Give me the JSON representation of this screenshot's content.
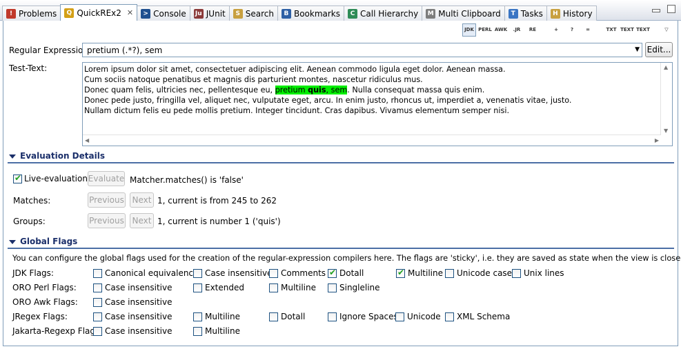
{
  "tabs": [
    {
      "label": "Problems",
      "icon": "problems-icon",
      "color": "#c0392b",
      "glyph": "!"
    },
    {
      "label": "QuickREx2",
      "icon": "quickrex-icon",
      "color": "#d4a017",
      "glyph": "Q",
      "active": true,
      "closable": true
    },
    {
      "label": "Console",
      "icon": "console-icon",
      "color": "#1f4f8f",
      "glyph": ">"
    },
    {
      "label": "JUnit",
      "icon": "junit-icon",
      "color": "#8b3a3a",
      "glyph": "Ju"
    },
    {
      "label": "Search",
      "icon": "search-icon",
      "color": "#c8a040",
      "glyph": "S"
    },
    {
      "label": "Bookmarks",
      "icon": "bookmarks-icon",
      "color": "#2d5fa5",
      "glyph": "B"
    },
    {
      "label": "Call Hierarchy",
      "icon": "call-hierarchy-icon",
      "color": "#2e8b57",
      "glyph": "C"
    },
    {
      "label": "Multi Clipboard",
      "icon": "multi-clipboard-icon",
      "color": "#7d7d7d",
      "glyph": "M"
    },
    {
      "label": "Tasks",
      "icon": "tasks-icon",
      "color": "#3a75c4",
      "glyph": "T"
    },
    {
      "label": "History",
      "icon": "history-icon",
      "color": "#c8a040",
      "glyph": "H"
    }
  ],
  "toolbar": [
    {
      "name": "jdk-regex-toggle",
      "glyph": "JDK"
    },
    {
      "name": "perl-regex-button",
      "glyph": "PERL"
    },
    {
      "name": "awk-regex-button",
      "glyph": "AWK"
    },
    {
      "name": "jregex-button",
      "glyph": ".JR"
    },
    {
      "name": "jakarta-regex-button",
      "glyph": "RE"
    },
    {
      "name": "add-to-library-button",
      "glyph": "+"
    },
    {
      "name": "organize-button",
      "glyph": "?"
    },
    {
      "name": "copy-to-clipboard-button",
      "glyph": "="
    },
    {
      "name": "text-button-1",
      "glyph": "TXT"
    },
    {
      "name": "text-button-2",
      "glyph": "TEXT"
    },
    {
      "name": "text-button-3",
      "glyph": "TEXT"
    },
    {
      "name": "view-menu-button",
      "glyph": "▽"
    }
  ],
  "regex": {
    "label": "Regular Expression:",
    "value": "pretium (.*?), sem",
    "edit_button": "Edit..."
  },
  "test_text": {
    "label": "Test-Text:",
    "line1": "Lorem ipsum dolor sit amet, consectetuer adipiscing elit. Aenean commodo ligula eget dolor. Aenean massa.",
    "line2": "Cum sociis natoque penatibus et magnis dis parturient montes, nascetur ridiculus mus.",
    "line3_pre": "Donec quam felis, ultricies nec, pellentesque eu, ",
    "line3_match_a": "pretium ",
    "line3_match_b": "quis",
    "line3_match_c": ", sem",
    "line3_post": ". Nulla consequat massa quis enim.",
    "line4": "Donec pede justo, fringilla vel, aliquet nec, vulputate eget, arcu. In enim justo, rhoncus ut, imperdiet a, venenatis vitae, justo.",
    "line5": "Nullam dictum felis eu pede mollis pretium. Integer tincidunt. Cras dapibus. Vivamus elementum semper nisi.",
    "highlight_color": "#00ee00"
  },
  "evaluation": {
    "title": "Evaluation Details",
    "live_label": "Live-evaluation",
    "live_checked": true,
    "evaluate_button": "Evaluate",
    "matcher_text": "Matcher.matches() is 'false'",
    "matches_label": "Matches:",
    "previous_button": "Previous",
    "next_button": "Next",
    "matches_text": "1, current is from 245 to 262",
    "groups_label": "Groups:",
    "groups_text": "1, current is number 1 ('quis')"
  },
  "flags": {
    "title": "Global Flags",
    "description": "You can configure the global flags used for the creation of the regular-expression compilers here. The flags are 'sticky', i.e. they are saved as state when the view is closed.",
    "jdk": {
      "label": "JDK Flags:",
      "items": [
        {
          "text": "Canonical equivalence",
          "checked": false
        },
        {
          "text": "Case insensitive",
          "checked": false
        },
        {
          "text": "Comments",
          "checked": false
        },
        {
          "text": "Dotall",
          "checked": true
        },
        {
          "text": "Multiline",
          "checked": true
        },
        {
          "text": "Unicode case",
          "checked": false
        },
        {
          "text": "Unix lines",
          "checked": false
        }
      ]
    },
    "oro_perl": {
      "label": "ORO Perl Flags:",
      "items": [
        {
          "text": "Case insensitive",
          "checked": false
        },
        {
          "text": "Extended",
          "checked": false
        },
        {
          "text": "Multiline",
          "checked": false
        },
        {
          "text": "Singleline",
          "checked": false
        }
      ]
    },
    "oro_awk": {
      "label": "ORO Awk Flags:",
      "items": [
        {
          "text": "Case insensitive",
          "checked": false
        }
      ]
    },
    "jregex": {
      "label": "JRegex Flags:",
      "items": [
        {
          "text": "Case insensitive",
          "checked": false
        },
        {
          "text": "Multiline",
          "checked": false
        },
        {
          "text": "Dotall",
          "checked": false
        },
        {
          "text": "Ignore Spaces",
          "checked": false
        },
        {
          "text": "Unicode",
          "checked": false
        },
        {
          "text": "XML Schema",
          "checked": false
        }
      ]
    },
    "jakarta": {
      "label": "Jakarta-Regexp Flags:",
      "items": [
        {
          "text": "Case insensitive",
          "checked": false
        },
        {
          "text": "Multiline",
          "checked": false
        }
      ]
    }
  }
}
